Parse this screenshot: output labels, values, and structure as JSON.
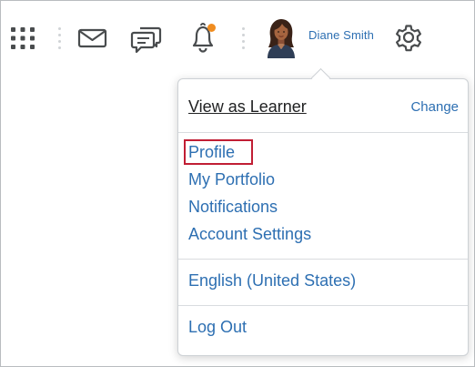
{
  "header": {
    "user_name": "Diane Smith",
    "notification_badge_color": "#f08c1f",
    "icons": [
      "apps-grid-icon",
      "mail-icon",
      "chat-icon",
      "bell-icon",
      "avatar",
      "gear-icon"
    ]
  },
  "menu": {
    "view_as_learner": "View as Learner",
    "change": "Change",
    "items": [
      "Profile",
      "My Portfolio",
      "Notifications",
      "Account Settings"
    ],
    "language": "English (United States)",
    "logout": "Log Out",
    "highlighted_item": "Profile"
  },
  "colors": {
    "link": "#2d6fb2",
    "highlight": "#c11e34"
  }
}
